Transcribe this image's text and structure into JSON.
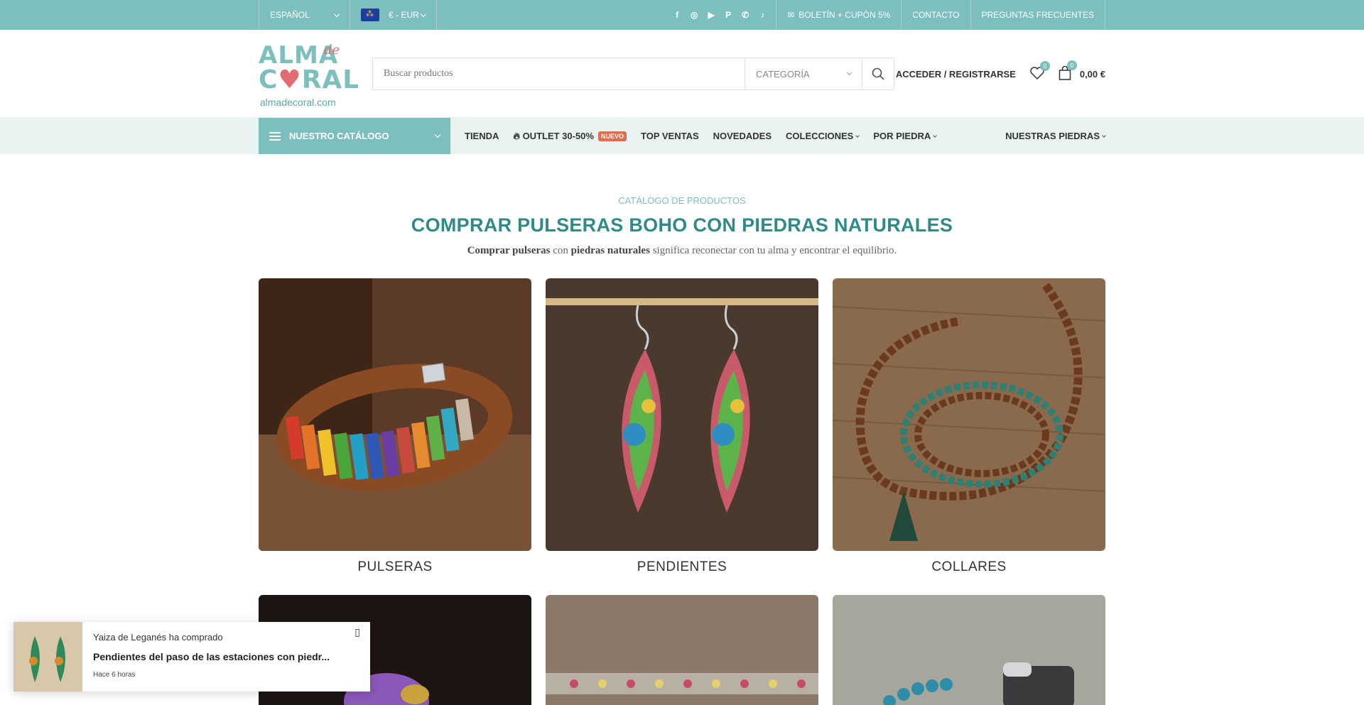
{
  "topbar": {
    "language": "ESPAÑOL",
    "currency": "€ - EUR",
    "social_icons": [
      "facebook-icon",
      "instagram-icon",
      "youtube-icon",
      "pinterest-icon",
      "whatsapp-icon",
      "tiktok-icon"
    ],
    "newsletter": "BOLETÍN + CUPÓN 5%",
    "contact": "CONTACTO",
    "faq": "PREGUNTAS FRECUENTES"
  },
  "header": {
    "logo": {
      "line1": "ALMA",
      "line1_script": "de",
      "line2_a": "C",
      "line2_b": "RAL",
      "domain": "almadecoral.com"
    },
    "search_placeholder": "Buscar productos",
    "category": "CATEGORÍA",
    "login": "ACCEDER / REGISTRARSE",
    "wishlist_count": "0",
    "cart_count": "0",
    "cart_total": "0,00 €"
  },
  "nav": {
    "catalog": "NUESTRO CATÁLOGO",
    "links": {
      "tienda": "TIENDA",
      "outlet": "OUTLET 30-50%",
      "outlet_badge": "NUEVO",
      "top": "TOP VENTAS",
      "novedades": "NOVEDADES",
      "colecciones": "COLECCIONES",
      "por_piedra": "POR PIEDRA"
    },
    "right": "NUESTRAS PIEDRAS"
  },
  "main": {
    "kicker": "CATÁLOGO DE PRODUCTOS",
    "title": "COMPRAR PULSERAS BOHO CON PIEDRAS NATURALES",
    "subtitle_b1": "Comprar pulseras",
    "subtitle_t1": " con ",
    "subtitle_b2": "piedras naturales",
    "subtitle_t2": " significa reconectar con tu alma y encontrar el equilibrio.",
    "categories": [
      {
        "label": "PULSERAS"
      },
      {
        "label": "PENDIENTES"
      },
      {
        "label": "COLLARES"
      }
    ]
  },
  "popup": {
    "who": "Yaiza de Leganés ha comprado",
    "product": "Pendientes del paso de las estaciones con piedr...",
    "when": "Hace 6 horas"
  },
  "colors": {
    "accent": "#7dbfbd",
    "title": "#2f8a88",
    "nav_bg": "#e8f3f2",
    "badge": "#e26d4a"
  }
}
